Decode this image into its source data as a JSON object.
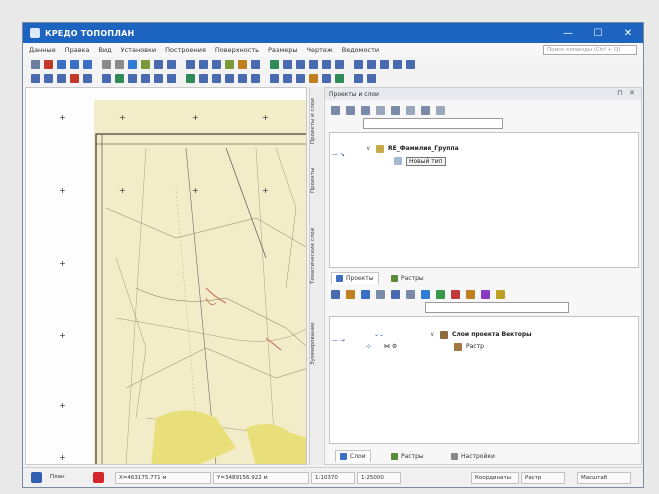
{
  "window": {
    "title": "КРЕДО ТОПОПЛАН",
    "controls": [
      "—",
      "☐",
      "✕"
    ]
  },
  "menu": {
    "items": [
      "Данные",
      "Правка",
      "Вид",
      "Установки",
      "Построения",
      "Поверхность",
      "Размеры",
      "Чертеж",
      "Ведомости"
    ],
    "search_placeholder": "Поиск команды (Ctrl + Q)"
  },
  "toolbar_icon_colors": {
    "row1": [
      "#6a7fa0",
      "#c0392b",
      "#3a6fc4",
      "#3a6fc4",
      "#3a6fc4",
      "#8a8a8a",
      "#8a8a8a",
      "#2e7bd6",
      "#7a9a3a",
      "#4a6ab0",
      "#4a6ab0",
      "#4a6ab0",
      "#4a6ab0",
      "#4a6ab0",
      "#7a9a3a",
      "#c08020",
      "#4a6ab0",
      "#2e8b57",
      "#4a6ab0",
      "#4a6ab0",
      "#4a6ab0",
      "#4a6ab0",
      "#4a6ab0",
      "#4a6ab0",
      "#4a6ab0",
      "#4a6ab0",
      "#4a6ab0",
      "#4a6ab0"
    ],
    "row2": [
      "#4a6ab0",
      "#4a6ab0",
      "#4a6ab0",
      "#c0392b",
      "#4a6ab0",
      "#4a6ab0",
      "#2e8b57",
      "#4a6ab0",
      "#4a6ab0",
      "#4a6ab0",
      "#4a6ab0",
      "#2e8b57",
      "#4a6ab0",
      "#4a6ab0",
      "#4a6ab0",
      "#4a6ab0",
      "#4a6ab0",
      "#4a6ab0",
      "#4a6ab0",
      "#4a6ab0",
      "#c08020",
      "#4a6ab0",
      "#2e8b57",
      "#4a6ab0",
      "#4a6ab0"
    ]
  },
  "vertical_tabs": [
    "Проекты и слои",
    "Проекты",
    "Тематические слои",
    "Зуммирование"
  ],
  "panel": {
    "title": "Проекты и слои",
    "pin": "⊓",
    "close": "✕",
    "top_tree": {
      "node_label": "RE_Фамилия_Группа",
      "child_label": "Новый тип"
    },
    "mid_tabs": [
      "Проекты",
      "Растры"
    ],
    "bottom_tree": {
      "node_label": "Слои проекта Векторы",
      "child_label": "Растр"
    },
    "bottom_tabs": [
      "Слои",
      "Растры",
      "Настройки"
    ]
  },
  "status": {
    "plan_label": "План",
    "x_coord": "X=463175.771 м",
    "y_coord": "Y=3489156.922 м",
    "scale1": "1:10370",
    "scale2": "1:25000",
    "btn1": "Координаты",
    "btn2": "Растр",
    "btn3": "Масштаб"
  },
  "colors": {
    "accent": "#1d63c0",
    "map_paper": "#f3ecc8",
    "map_yellow": "#e8df7a"
  }
}
